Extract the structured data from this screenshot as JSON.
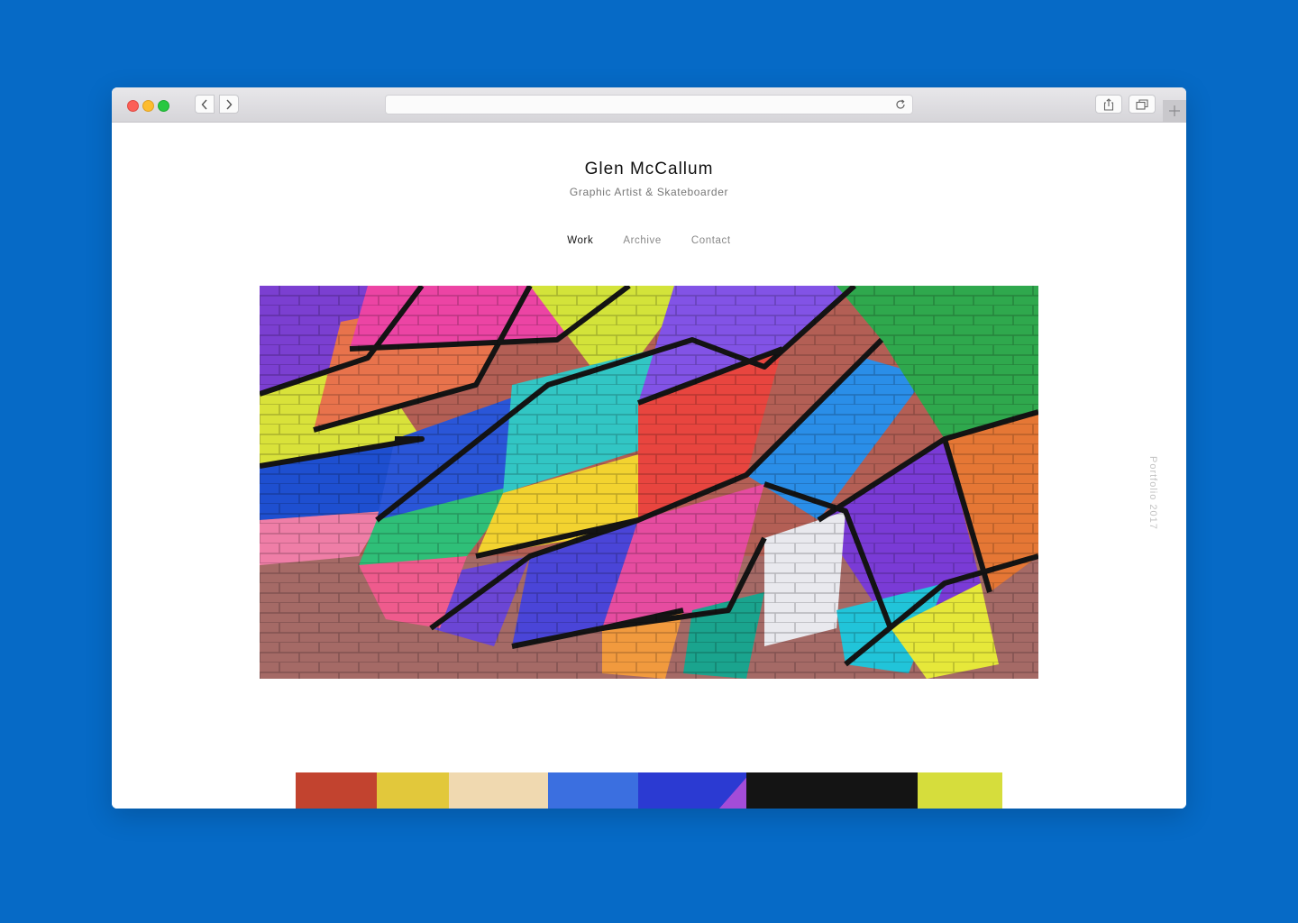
{
  "site": {
    "title": "Glen McCallum",
    "subtitle": "Graphic Artist & Skateboarder",
    "side_label": "Portfolio 2017"
  },
  "nav": [
    {
      "label": "Work",
      "active": true
    },
    {
      "label": "Archive",
      "active": false
    },
    {
      "label": "Contact",
      "active": false
    }
  ],
  "browser": {
    "url": "",
    "icons": [
      "back-arrow-icon",
      "forward-arrow-icon",
      "reload-icon",
      "share-icon",
      "tabs-icon",
      "plus-icon"
    ]
  },
  "colors": {
    "background": "#066ac6",
    "title": "#111111",
    "muted": "#888888"
  },
  "images": [
    {
      "subject": "colorful geometric graffiti mural on brick wall"
    },
    {
      "subject": "colorful graffiti mural (partially visible)"
    }
  ]
}
